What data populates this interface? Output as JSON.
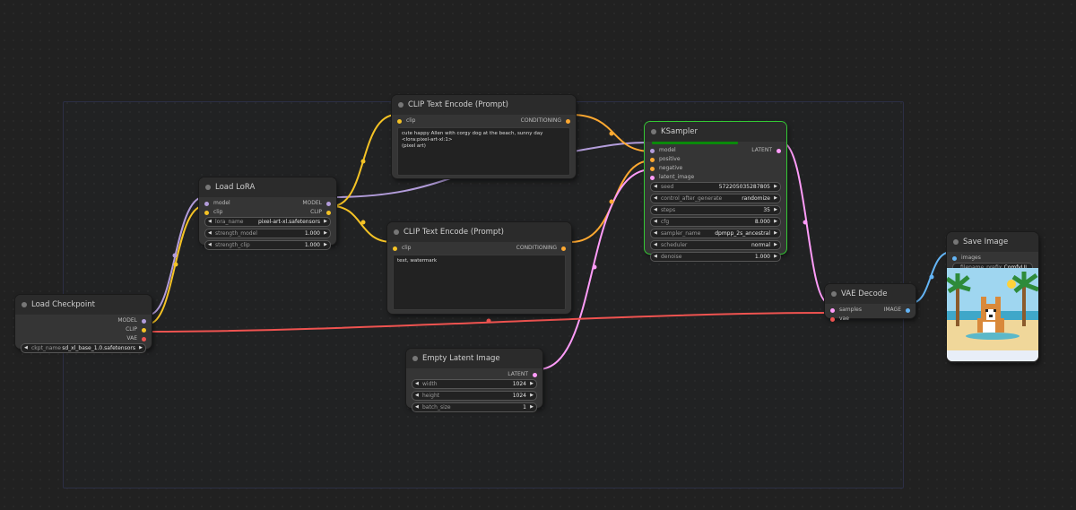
{
  "nodes": {
    "load_checkpoint": {
      "title": "Load Checkpoint",
      "outputs": [
        "MODEL",
        "CLIP",
        "VAE"
      ],
      "widgets": [
        {
          "name": "ckpt_name",
          "value": "sd_xl_base_1.0.safetensors"
        }
      ]
    },
    "load_lora": {
      "title": "Load LoRA",
      "inputs": [
        "model",
        "clip"
      ],
      "outputs": [
        "MODEL",
        "CLIP"
      ],
      "widgets": [
        {
          "name": "lora_name",
          "value": "pixel-art-xl.safetensors"
        },
        {
          "name": "strength_model",
          "value": "1.000"
        },
        {
          "name": "strength_clip",
          "value": "1.000"
        }
      ]
    },
    "clip_pos": {
      "title": "CLIP Text Encode (Prompt)",
      "input": "clip",
      "output": "CONDITIONING",
      "text": "cute happy Allen with corgy dog at the beach, sunny day <lora:pixel-art-xl:1>\n(pixel art)"
    },
    "clip_neg": {
      "title": "CLIP Text Encode (Prompt)",
      "input": "clip",
      "output": "CONDITIONING",
      "text": "text, watermark"
    },
    "ksampler": {
      "title": "KSampler",
      "inputs": [
        "model",
        "positive",
        "negative",
        "latent_image"
      ],
      "output": "LATENT",
      "widgets": [
        {
          "name": "seed",
          "value": "572205035287805"
        },
        {
          "name": "control_after_generate",
          "value": "randomize"
        },
        {
          "name": "steps",
          "value": "35"
        },
        {
          "name": "cfg",
          "value": "8.000"
        },
        {
          "name": "sampler_name",
          "value": "dpmpp_2s_ancestral"
        },
        {
          "name": "scheduler",
          "value": "normal"
        },
        {
          "name": "denoise",
          "value": "1.000"
        }
      ]
    },
    "empty_latent": {
      "title": "Empty Latent Image",
      "output": "LATENT",
      "widgets": [
        {
          "name": "width",
          "value": "1024"
        },
        {
          "name": "height",
          "value": "1024"
        },
        {
          "name": "batch_size",
          "value": "1"
        }
      ]
    },
    "vae_decode": {
      "title": "VAE Decode",
      "inputs": [
        "samples",
        "vae"
      ],
      "output": "IMAGE"
    },
    "save_image": {
      "title": "Save Image",
      "input": "images",
      "widget": {
        "name": "filename_prefix",
        "value": "ComfyUI"
      }
    }
  },
  "colors": {
    "model": "#b39ddb",
    "clip": "#f5c325",
    "vae": "#ef5350",
    "conditioning": "#ffa931",
    "latent": "#ff9cf9",
    "image": "#64b5f6",
    "selected_outline": "#34c934"
  }
}
